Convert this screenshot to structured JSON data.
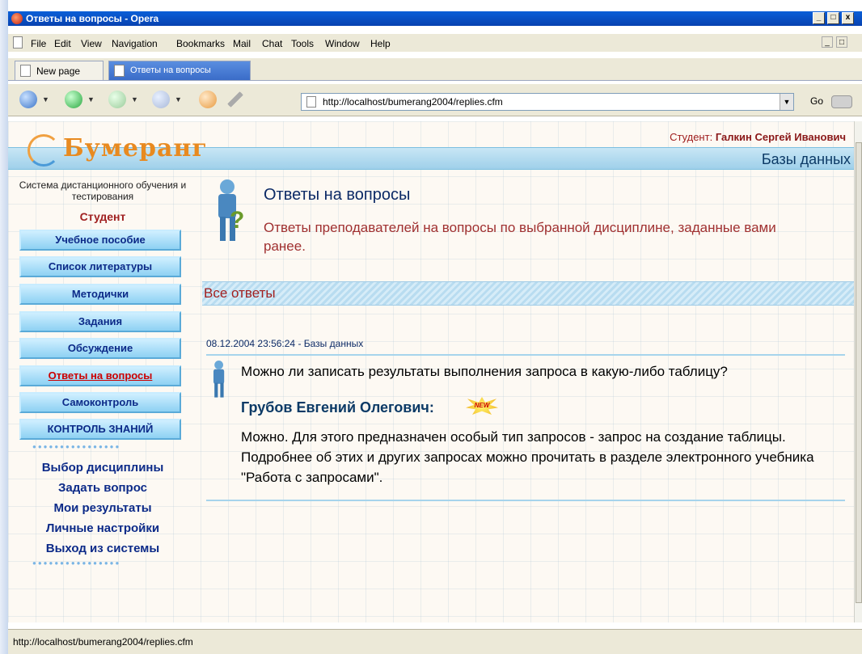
{
  "window": {
    "title": "Ответы на вопросы - Opera",
    "min_glyph": "_",
    "max_glyph": "□",
    "close_glyph": "x"
  },
  "menubar": {
    "items": [
      "File",
      "Edit",
      "View",
      "Navigation",
      "Bookmarks",
      "Mail",
      "Chat",
      "Tools",
      "Window",
      "Help"
    ]
  },
  "tabs": [
    {
      "label": "New page"
    },
    {
      "label": "Ответы на вопросы"
    }
  ],
  "navbar": {
    "address": "http://localhost/bumerang2004/replies.cfm",
    "go_label": "Go"
  },
  "page": {
    "student_prefix": "Студент:",
    "student_name": "Галкин Сергей Иванович",
    "subject": "Базы данных",
    "logo_text": "Бумеранг",
    "tagline": "Система дистанционного обучения и тестирования",
    "role": "Студент",
    "nav_buttons": [
      {
        "label": "Учебное пособие"
      },
      {
        "label": "Список литературы"
      },
      {
        "label": "Методички"
      },
      {
        "label": "Задания"
      },
      {
        "label": "Обсуждение"
      },
      {
        "label": "Ответы на вопросы"
      },
      {
        "label": "Самоконтроль"
      },
      {
        "label": "КОНТРОЛЬ ЗНАНИЙ"
      }
    ],
    "links": [
      {
        "label": "Выбор дисциплины"
      },
      {
        "label": "Задать вопрос"
      },
      {
        "label": "Мои результаты"
      },
      {
        "label": "Личные настройки"
      },
      {
        "label": "Выход из системы"
      }
    ],
    "title": "Ответы на вопросы",
    "description": "Ответы преподавателей на вопросы по выбранной дисциплине, заданные вами ранее.",
    "section_title": "Все ответы",
    "message": {
      "meta": "08.12.2004 23:56:24 - Базы данных",
      "question": "Можно ли записать результаты выполнения запроса в какую-либо таблицу?",
      "author": "Грубов Евгений Олегович:",
      "badge": "NEW",
      "answer": "Можно. Для этого предназначен особый тип запросов - запрос на создание таблицы. Подробнее об этих и других запросах можно прочитать в разделе электронного учебника \"Работа с запросами\"."
    }
  },
  "statusbar": {
    "text": "http://localhost/bumerang2004/replies.cfm"
  },
  "colors": {
    "title_bar": "#0842b0",
    "nav_button": "#8ed1f3",
    "active_nav": "#cc0000",
    "heading": "#0c2a66",
    "accent_red": "#a02020"
  }
}
